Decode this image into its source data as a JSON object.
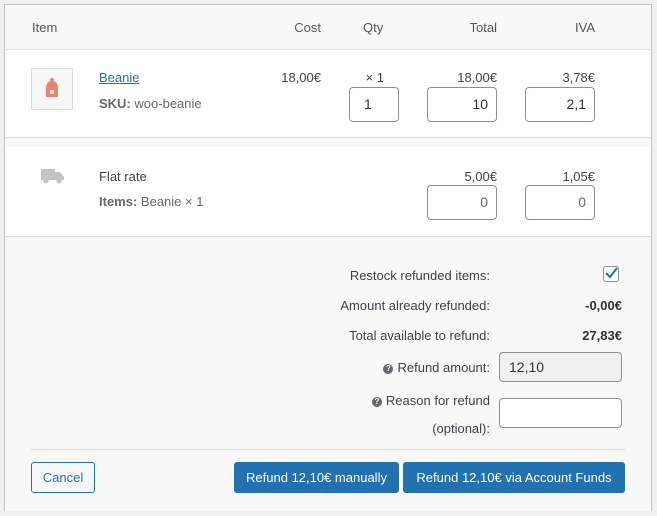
{
  "header": {
    "item": "Item",
    "cost": "Cost",
    "qty": "Qty",
    "total": "Total",
    "tax": "IVA"
  },
  "product": {
    "name": "Beanie",
    "sku_label": "SKU:",
    "sku": "woo-beanie",
    "cost": "18,00€",
    "qty": "× 1",
    "total": "18,00€",
    "tax": "3,78€",
    "refund_qty": "1",
    "refund_total": "10",
    "refund_tax": "2,1"
  },
  "shipping": {
    "name": "Flat rate",
    "items_label": "Items:",
    "items": "Beanie × 1",
    "total": "5,00€",
    "tax": "1,05€",
    "refund_total": "0",
    "refund_tax": "0"
  },
  "refund": {
    "restock_label": "Restock refunded items:",
    "restock_checked": true,
    "already_label": "Amount already refunded:",
    "already_value": "-0,00€",
    "available_label": "Total available to refund:",
    "available_value": "27,83€",
    "amount_label": "Refund amount:",
    "amount_value": "12,10",
    "reason_label_1": "Reason for refund",
    "reason_label_2": "(optional):",
    "reason_value": ""
  },
  "buttons": {
    "cancel": "Cancel",
    "manual": "Refund 12,10€ manually",
    "funds": "Refund 12,10€ via Account Funds"
  },
  "colors": {
    "accent": "#2271b1",
    "product_icon": "#e8836f"
  }
}
